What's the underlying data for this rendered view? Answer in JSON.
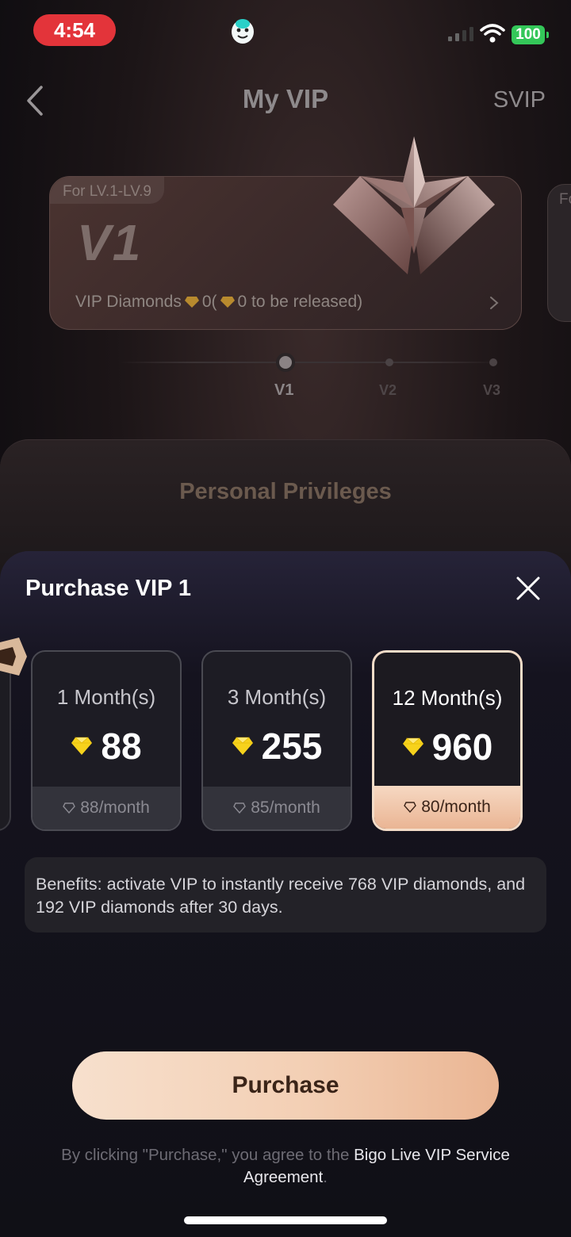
{
  "status_bar": {
    "time": "4:54",
    "battery": "100",
    "accent": "#e3343a",
    "battery_color": "#34c759"
  },
  "nav": {
    "title": "My VIP",
    "right_link": "SVIP"
  },
  "vip_card": {
    "tag": "For LV.1-LV.9",
    "level": "V1",
    "diamonds_label": "VIP Diamonds",
    "diamonds_value": "0(",
    "pending_text": "0 to be released)"
  },
  "next_card": {
    "tag": "Fo"
  },
  "levels": [
    {
      "label": "V1",
      "active": true
    },
    {
      "label": "V2",
      "active": false
    },
    {
      "label": "V3",
      "active": false
    }
  ],
  "privileges": {
    "title": "Personal Privileges"
  },
  "purchase_sheet": {
    "title": "Purchase VIP 1",
    "plans": [
      {
        "duration": "1 Month(s)",
        "price": "88",
        "per_month": "88/month",
        "selected": false
      },
      {
        "duration": "3 Month(s)",
        "price": "255",
        "per_month": "85/month",
        "selected": false
      },
      {
        "duration": "12 Month(s)",
        "price": "960",
        "per_month": "80/month",
        "selected": true
      }
    ],
    "benefits": "Benefits: activate VIP to instantly receive 768 VIP diamonds, and 192 VIP diamonds after 30 days.",
    "purchase_label": "Purchase",
    "agreement_prefix": "By clicking \"Purchase,\" you agree to the",
    "agreement_link": "Bigo Live VIP Service Agreement",
    "agreement_suffix": "."
  },
  "colors": {
    "purchase_button": "#f3cfb4",
    "gem": "#f7d21c",
    "selected_plan_border": "#f3dcc8"
  }
}
